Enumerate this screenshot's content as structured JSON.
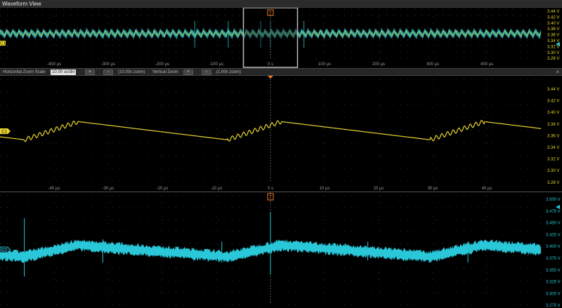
{
  "window": {
    "title": "Waveform View"
  },
  "overview": {
    "x_ticks": [
      {
        "label": "-400 µs",
        "value": -400
      },
      {
        "label": "-300 µs",
        "value": -300
      },
      {
        "label": "-200 µs",
        "value": -200
      },
      {
        "label": "-100 µs",
        "value": -100
      },
      {
        "label": "0 s",
        "value": 0
      },
      {
        "label": "100 µs",
        "value": 100
      },
      {
        "label": "200 µs",
        "value": 200
      },
      {
        "label": "300 µs",
        "value": 300
      },
      {
        "label": "400 µs",
        "value": 400
      }
    ],
    "y_ticks": [
      "3.44 V",
      "3.42 V",
      "3.40 V",
      "3.38 V",
      "3.36 V",
      "3.34 V",
      "3.32 V",
      "3.30 V",
      "3.28 V"
    ],
    "x_range_us": [
      -500,
      500
    ],
    "zoom_window_us": [
      -50,
      50
    ],
    "trigger_label": "T",
    "ch1_label": "C1"
  },
  "zoom_controls": {
    "horizontal_label": "Horizontal Zoom Scale",
    "horizontal_value": "10.00 us/div",
    "horizontal_zoom_text": "(10.00x zoom)",
    "vertical_label": "Vertical Zoom",
    "vertical_zoom_text": "(1.00x zoom)",
    "close_symbol": "×"
  },
  "zoom_ch1": {
    "y_ticks": [
      "3.44 V",
      "3.42 V",
      "3.40 V",
      "3.38 V",
      "3.36 V",
      "3.34 V",
      "3.32 V",
      "3.30 V",
      "3.28 V"
    ],
    "y_range_v": [
      3.27,
      3.455
    ],
    "x_ticks": [
      {
        "label": "-40 µs",
        "value": -40
      },
      {
        "label": "-30 µs",
        "value": -30
      },
      {
        "label": "-20 µs",
        "value": -20
      },
      {
        "label": "-10 µs",
        "value": -10
      },
      {
        "label": "0 s",
        "value": 0
      },
      {
        "label": "10 µs",
        "value": 10
      },
      {
        "label": "20 µs",
        "value": 20
      },
      {
        "label": "30 µs",
        "value": 30
      },
      {
        "label": "40 µs",
        "value": 40
      }
    ],
    "x_range_us": [
      -50,
      50
    ],
    "label": "C1",
    "color": "#e8d52c"
  },
  "zoom_ch2": {
    "y_ticks": [
      "3.500 V",
      "3.475 V",
      "3.450 V",
      "3.425 V",
      "3.400 V",
      "3.375 V",
      "3.350 V",
      "3.325 V",
      "3.300 V",
      "3.275 V"
    ],
    "y_range_v": [
      3.27,
      3.505
    ],
    "label": "C2",
    "trigger_label": "T",
    "color": "#29c7d8"
  },
  "colors": {
    "ch1": "#e8d52c",
    "ch2": "#29c7d8",
    "trigger": "#f07a2a"
  }
}
